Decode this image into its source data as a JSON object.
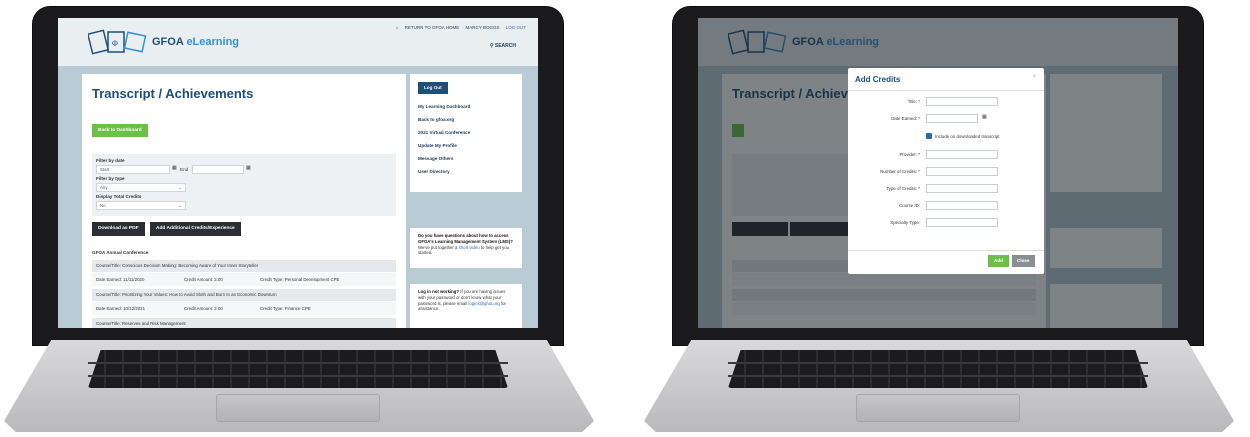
{
  "brand": {
    "name_prefix": "GFOA ",
    "name_suffix": "eLearning"
  },
  "topnav": {
    "home": "RETURN TO GFOA HOME",
    "user": "MARCY BOGGS",
    "logout": "LOG OUT",
    "search": "SEARCH"
  },
  "page": {
    "title": "Transcript / Achievements",
    "back_button": "Back to Dashboard",
    "filter_date_label": "Filter by date",
    "start_placeholder": "Start",
    "end_label": "End",
    "filter_type_label": "Filter by type",
    "type_value": "Any",
    "display_credits_label": "Display Total Credits",
    "display_credits_value": "No",
    "download_button": "Download as PDF",
    "add_credits_button": "Add Additional Credits/Experience",
    "section_title": "GFOA Annual Conference",
    "records": [
      {
        "course": "Course/Title: Conscious Decision Making: Becoming Aware of Your Inner Storyteller",
        "date": "Date Earned: 11/11/2020",
        "amount": "Credit Amount: 2.00",
        "type": "Credit Type: Personal Development CPE"
      },
      {
        "course": "Course/Title: Prioritizing Your Values: How to Avoid Sloth and Burn In an Economic Downturn",
        "date": "Date Earned: 10/12/2021",
        "amount": "Credit Amount: 2.00",
        "type": "Credit Type: Finance CPE"
      },
      {
        "course": "Course/Title: Reserves and Risk Management"
      }
    ]
  },
  "sidebar": {
    "logout_button": "Log Out",
    "links": [
      "My Learning Dashboard",
      "Back to gfoa.org",
      "2021 Virtual Conference",
      "Update My Profile",
      "Message Others",
      "User Directory"
    ],
    "help_bold": "Do you have questions about how to access GFOA's Learning Management System (LMS)?",
    "help_text": " We've put together a ",
    "help_link": "short video",
    "help_tail": " to help get you started.",
    "login_bold": "Log in not working?",
    "login_text": " If you are having issues with your password or don't know what your password is, please email ",
    "login_link": "logins@gfoa.org",
    "login_tail": " for assistance."
  },
  "modal": {
    "title": "Add Credits",
    "close_x": "×",
    "fields": {
      "title": "Title: *",
      "date_earned": "Date Earned: *",
      "include_label": "Include on downloaded transcript",
      "provider": "Provider: *",
      "num_credits": "Number of Credits: *",
      "type_credits": "Type of Credits: *",
      "course_id": "Course ID:",
      "specialty": "Specialty Type:"
    },
    "add_button": "Add",
    "close_button": "Close"
  },
  "colors": {
    "brand_blue": "#1f4e79",
    "accent_green": "#6cc04a",
    "link_blue": "#2e6aa8"
  }
}
